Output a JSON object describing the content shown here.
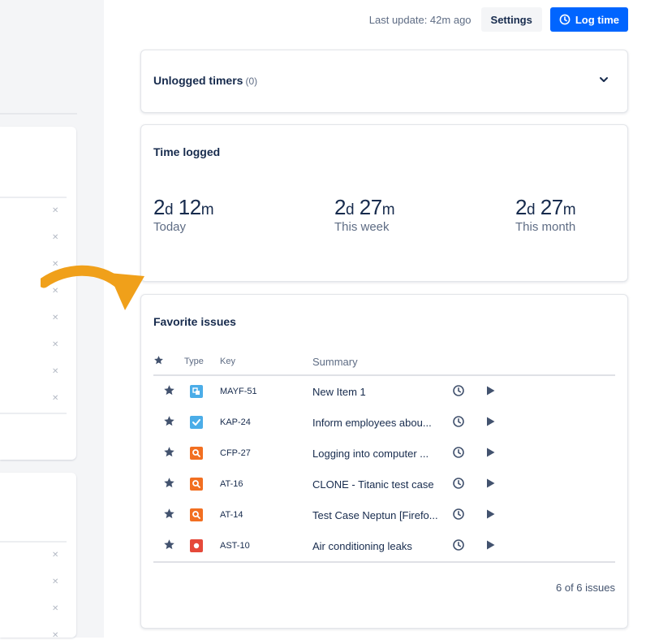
{
  "colors": {
    "accent": "#0065ff",
    "arrow": "#f0a01a",
    "type_story": "#4bade8",
    "type_task": "#4bade8",
    "type_test": "#f26f21",
    "type_bug": "#e5493a"
  },
  "header": {
    "last_update": "Last update: 42m ago",
    "settings_label": "Settings",
    "log_time_label": "Log time"
  },
  "unlogged": {
    "title": "Unlogged timers",
    "count": "(0)"
  },
  "time_logged": {
    "title": "Time logged",
    "stats": [
      {
        "days": "2",
        "days_unit": "d",
        "mins": "12",
        "mins_unit": "m",
        "label": "Today"
      },
      {
        "days": "2",
        "days_unit": "d",
        "mins": "27",
        "mins_unit": "m",
        "label": "This week"
      },
      {
        "days": "2",
        "days_unit": "d",
        "mins": "27",
        "mins_unit": "m",
        "label": "This month"
      }
    ]
  },
  "favorites": {
    "title": "Favorite issues",
    "columns": {
      "type": "Type",
      "key": "Key",
      "summary": "Summary"
    },
    "rows": [
      {
        "type": "story-icon",
        "key": "MAYF-51",
        "summary": "New Item 1"
      },
      {
        "type": "task-icon",
        "key": "KAP-24",
        "summary": "Inform employees abou..."
      },
      {
        "type": "test-icon",
        "key": "CFP-27",
        "summary": "Logging into computer ..."
      },
      {
        "type": "test-icon",
        "key": "AT-16",
        "summary": "CLONE - Titanic test case"
      },
      {
        "type": "test-icon",
        "key": "AT-14",
        "summary": "Test Case Neptun [Firefo..."
      },
      {
        "type": "bug-icon",
        "key": "AST-10",
        "summary": "Air conditioning leaks"
      }
    ],
    "footer": "6 of 6 issues"
  }
}
